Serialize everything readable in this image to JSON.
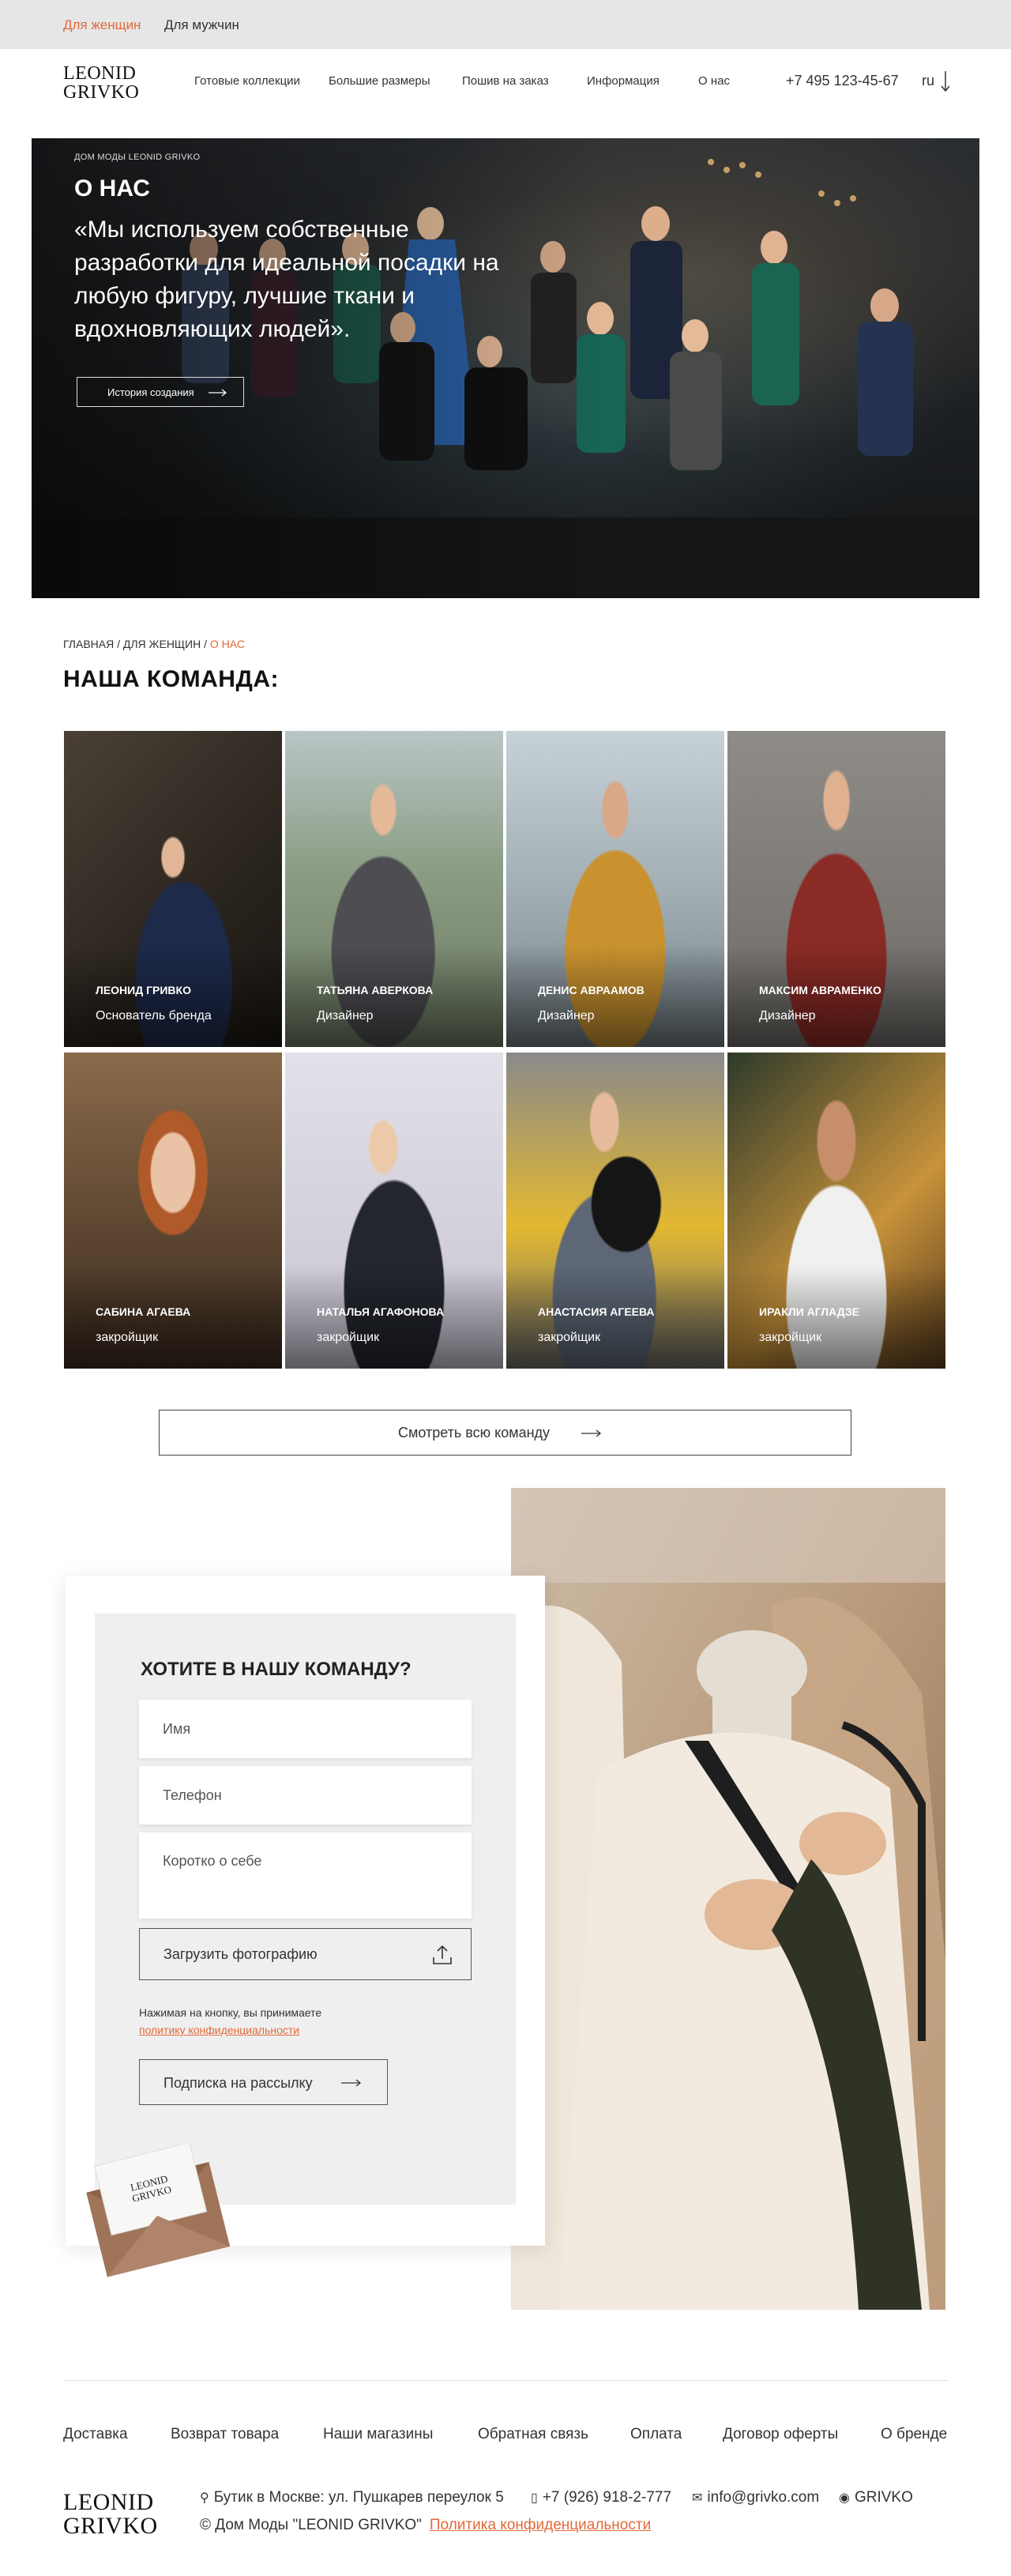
{
  "topbar": {
    "women": "Для женщин",
    "men": "Для мужчин"
  },
  "header": {
    "logo_line1": "LEONID",
    "logo_line2": "GRIVKO",
    "nav": [
      "Готовые коллекции",
      "Большие размеры",
      "Пошив на заказ",
      "Информация",
      "О нас"
    ],
    "phone": "+7 495 123-45-67",
    "lang": "ru"
  },
  "hero": {
    "small": "ДОМ МОДЫ LEONID GRIVKO",
    "title": "О НАС",
    "quote": "«Мы используем собственные разработки для идеальной посадки на любую фигуру, лучшие ткани и вдохновляющих людей».",
    "button": "История создания"
  },
  "breadcrumb": {
    "home": "ГЛАВНАЯ",
    "sep": " / ",
    "parent": "ДЛЯ ЖЕНЩИН",
    "current": "О НАС"
  },
  "team": {
    "title": "НАША КОМАНДА:",
    "members": [
      {
        "name": "ЛЕОНИД ГРИВКО",
        "role": "Основатель бренда"
      },
      {
        "name": "ТАТЬЯНА АВЕРКОВА",
        "role": "Дизайнер"
      },
      {
        "name": "ДЕНИС АВРААМОВ",
        "role": "Дизайнер"
      },
      {
        "name": "МАКСИМ АВРАМЕНКО",
        "role": "Дизайнер"
      },
      {
        "name": "САБИНА АГАЕВА",
        "role": "закройщик"
      },
      {
        "name": "НАТАЛЬЯ АГАФОНОВА",
        "role": "закройщик"
      },
      {
        "name": "АНАСТАСИЯ АГЕЕВА",
        "role": "закройщик"
      },
      {
        "name": "ИРАКЛИ АГЛАДЗЕ",
        "role": "закройщик"
      }
    ],
    "button": "Смотреть всю команду"
  },
  "join": {
    "title": "ХОТИТЕ В НАШУ КОМАНДУ?",
    "name_placeholder": "Имя",
    "phone_placeholder": "Телефон",
    "about_placeholder": "Коротко о себе",
    "upload": "Загрузить фотографию",
    "consent_text": "Нажимая на кнопку, вы принимаете",
    "consent_link": "политику конфиденциальности",
    "subscribe": "Подписка на рассылку",
    "envelope_logo_line1": "LEONID",
    "envelope_logo_line2": "GRIVKO"
  },
  "footer": {
    "nav": [
      "Доставка",
      "Возврат товара",
      "Наши магазины",
      "Обратная связь",
      "Оплата",
      "Договор оферты",
      "О бренде"
    ],
    "logo_line1": "LEONID",
    "logo_line2": "GRIVKO",
    "address": "Бутик в Москве: ул. Пушкарев переулок 5",
    "phone": "+7 (926) 918-2-777",
    "email": "info@grivko.com",
    "social": "GRIVKO",
    "copyright": "© Дом Моды \"LEONID GRIVKO\"",
    "privacy": "Политика конфиденциальности"
  },
  "colors": {
    "accent": "#e2693a",
    "topbar": "#e6e6e6",
    "text": "#222222"
  },
  "icons": [
    "arrow-right-icon",
    "arrow-down-icon",
    "upload-icon",
    "location-icon",
    "phone-icon",
    "mail-icon",
    "instagram-icon"
  ]
}
